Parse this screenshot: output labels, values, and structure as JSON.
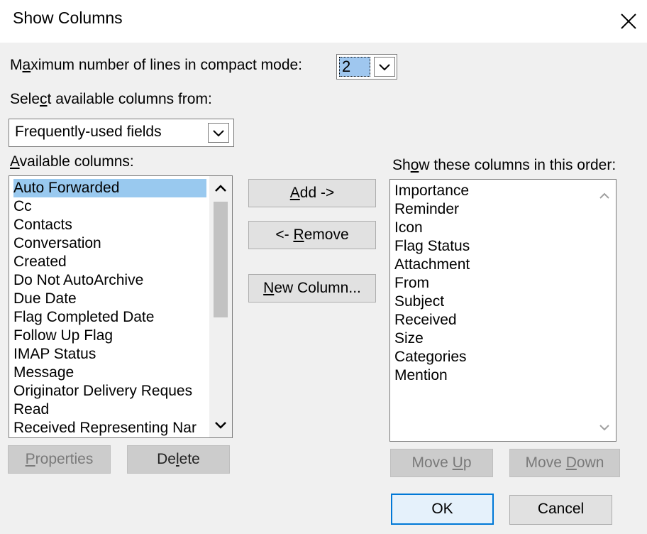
{
  "window": {
    "title": "Show Columns"
  },
  "max_lines": {
    "label_prefix": "M",
    "label_accel": "a",
    "label_suffix": "ximum number of lines in compact mode:",
    "value": "2"
  },
  "select_from": {
    "label_prefix": "Sele",
    "label_accel": "c",
    "label_suffix": "t available columns from:",
    "value": "Frequently-used fields"
  },
  "available": {
    "label_prefix": "",
    "label_accel": "A",
    "label_suffix": "vailable columns:",
    "items": [
      "Auto Forwarded",
      "Cc",
      "Contacts",
      "Conversation",
      "Created",
      "Do Not AutoArchive",
      "Due Date",
      "Flag Completed Date",
      "Follow Up Flag",
      "IMAP Status",
      "Message",
      "Originator Delivery Reques",
      "Read",
      "Received Representing Nar"
    ],
    "selected_index": 0,
    "scroll_fraction": 0.55
  },
  "shown": {
    "label_prefix": "Sh",
    "label_accel": "o",
    "label_suffix": "w these columns in this order:",
    "items": [
      "Importance",
      "Reminder",
      "Icon",
      "Flag Status",
      "Attachment",
      "From",
      "Subject",
      "Received",
      "Size",
      "Categories",
      "Mention"
    ]
  },
  "buttons": {
    "add": {
      "prefix": "",
      "accel": "A",
      "suffix": "dd ->"
    },
    "remove": {
      "prefix": "<- ",
      "accel": "R",
      "suffix": "emove"
    },
    "new_column": {
      "prefix": "",
      "accel": "N",
      "suffix": "ew Column..."
    },
    "properties": {
      "prefix": "",
      "accel": "P",
      "suffix": "roperties"
    },
    "delete": {
      "prefix": "De",
      "accel": "l",
      "suffix": "ete"
    },
    "move_up": {
      "prefix": "Move ",
      "accel": "U",
      "suffix": "p"
    },
    "move_down": {
      "prefix": "Move ",
      "accel": "D",
      "suffix": "own"
    },
    "ok": "OK",
    "cancel": "Cancel"
  },
  "colors": {
    "selection": "#99c9ef",
    "accent": "#0078d7"
  },
  "icons": {
    "close": "close-icon",
    "dropdown": "chevron-down-icon",
    "scroll_up": "chevron-up-icon",
    "scroll_down": "chevron-down-icon"
  }
}
